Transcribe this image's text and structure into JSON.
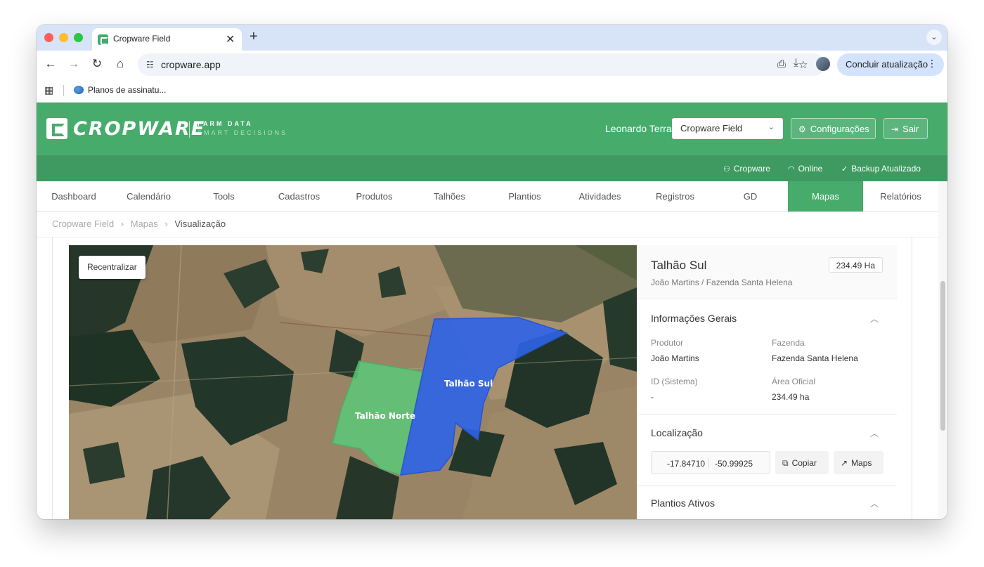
{
  "browser": {
    "tab_title": "Cropware Field",
    "tab_close": "✕",
    "new_tab": "+",
    "url": "cropware.app",
    "update_button": "Concluir atualização",
    "bookmark": "Planos de assinatu..."
  },
  "app": {
    "logo_text": "CROPWARE",
    "tagline_1": "FARM DATA",
    "tagline_2": "SMART DECISIONS",
    "user_name": "Leonardo Terra",
    "selected_app": "Cropware Field",
    "settings_button": "Configurações",
    "logout_button": "Sair",
    "brand_color": "#46ab6b"
  },
  "status": {
    "org": "Cropware",
    "connection": "Online",
    "backup": "Backup Atualizado"
  },
  "nav": {
    "items": [
      {
        "label": "Dashboard"
      },
      {
        "label": "Calendário"
      },
      {
        "label": "Tools"
      },
      {
        "label": "Cadastros"
      },
      {
        "label": "Produtos"
      },
      {
        "label": "Talhões"
      },
      {
        "label": "Plantios"
      },
      {
        "label": "Atividades"
      },
      {
        "label": "Registros"
      },
      {
        "label": "GD"
      },
      {
        "label": "Mapas"
      },
      {
        "label": "Relatórios"
      }
    ],
    "active": "Mapas"
  },
  "breadcrumb": {
    "items": [
      "Cropware Field",
      "Mapas"
    ],
    "current": "Visualização",
    "separator": "›"
  },
  "map": {
    "recenter_button": "Recentralizar",
    "fields": [
      {
        "name": "Talhão Norte",
        "color": "#5cc878"
      },
      {
        "name": "Talhão Sul",
        "color": "#2e64e8"
      }
    ]
  },
  "panel": {
    "title": "Talhão Sul",
    "area_badge": "234.49 Ha",
    "subtitle": "João Martins / Fazenda Santa Helena",
    "general_info": {
      "title": "Informações Gerais",
      "producer_label": "Produtor",
      "producer_value": "João Martins",
      "farm_label": "Fazenda",
      "farm_value": "Fazenda Santa Helena",
      "id_label": "ID (Sistema)",
      "id_value": "-",
      "area_label": "Área Oficial",
      "area_value": "234.49 ha"
    },
    "location": {
      "title": "Localização",
      "lat": "-17.84710",
      "lng": "-50.99925",
      "copy_button": "Copiar",
      "maps_button": "Maps"
    },
    "plantings": {
      "title": "Plantios Ativos"
    }
  }
}
